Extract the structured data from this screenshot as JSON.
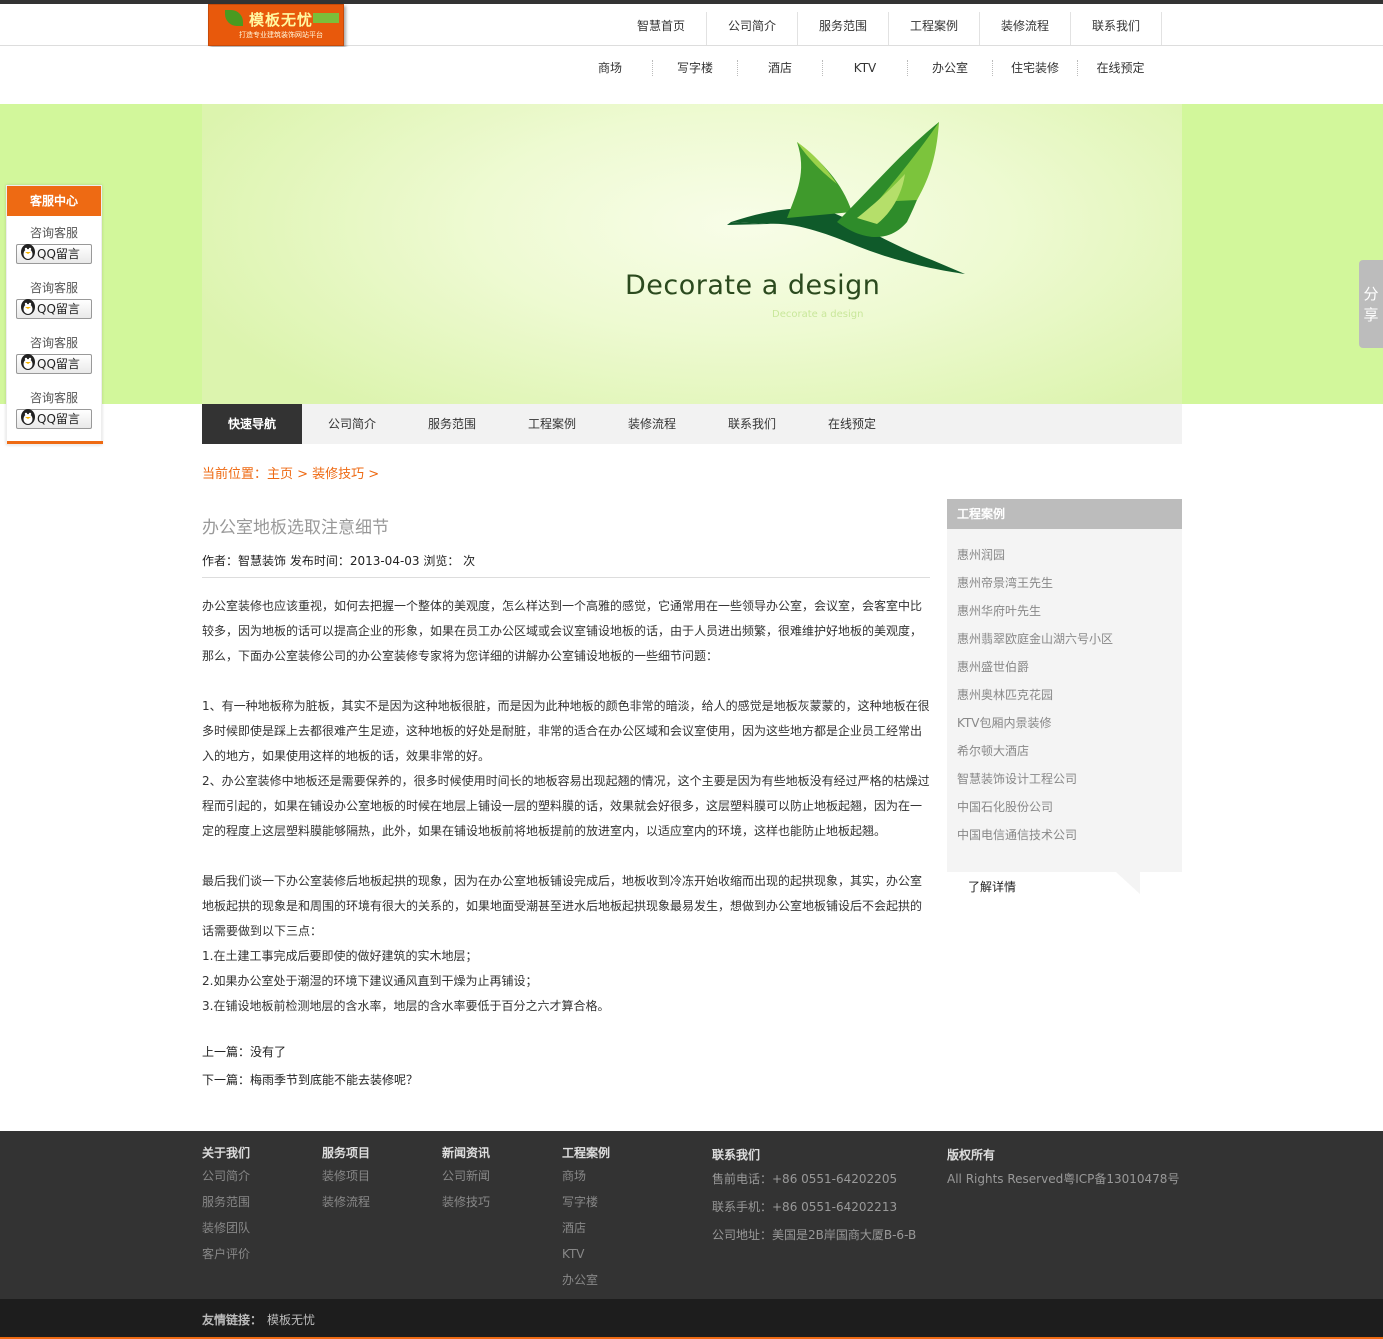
{
  "logo": {
    "title": "模板无忧",
    "subtitle": "打造专业建筑装饰网站平台"
  },
  "main_nav": [
    "智慧首页",
    "公司简介",
    "服务范围",
    "工程案例",
    "装修流程",
    "联系我们"
  ],
  "sub_nav": [
    "商场",
    "写字楼",
    "酒店",
    "KTV",
    "办公室",
    "住宅装修",
    "在线预定"
  ],
  "banner": {
    "text": "Decorate a design",
    "subtext": "Decorate a design"
  },
  "section_nav": [
    "快速导航",
    "公司简介",
    "服务范围",
    "工程案例",
    "装修流程",
    "联系我们",
    "在线预定"
  ],
  "breadcrumb": "当前位置：主页 > 装修技巧 >",
  "article": {
    "title": "办公室地板选取注意细节",
    "meta": "作者：智慧装饰 发布时间：2013-04-03 浏览： 次",
    "paragraphs": [
      "办公室装修也应该重视，如何去把握一个整体的美观度，怎么样达到一个高雅的感觉，它通常用在一些领导办公室，会议室，会客室中比较多，因为地板的话可以提高企业的形象，如果在员工办公区域或会议室铺设地板的话，由于人员进出频繁，很难维护好地板的美观度，那么，下面办公室装修公司的办公室装修专家将为您详细的讲解办公室铺设地板的一些细节问题：",
      "",
      "1、有一种地板称为脏板，其实不是因为这种地板很脏，而是因为此种地板的颜色非常的暗淡，给人的感觉是地板灰蒙蒙的，这种地板在很多时候即使是踩上去都很难产生足迹，这种地板的好处是耐脏，非常的适合在办公区域和会议室使用，因为这些地方都是企业员工经常出入的地方，如果使用这样的地板的话，效果非常的好。",
      "2、办公室装修中地板还是需要保养的，很多时候使用时间长的地板容易出现起翘的情况，这个主要是因为有些地板没有经过严格的枯燥过程而引起的，如果在铺设办公室地板的时候在地层上铺设一层的塑料膜的话，效果就会好很多，这层塑料膜可以防止地板起翘，因为在一定的程度上这层塑料膜能够隔热，此外，如果在铺设地板前将地板提前的放进室内，以适应室内的环境，这样也能防止地板起翘。",
      "",
      "最后我们谈一下办公室装修后地板起拱的现象，因为在办公室地板铺设完成后，地板收到冷冻开始收缩而出现的起拱现象，其实，办公室地板起拱的现象是和周围的环境有很大的关系的，如果地面受潮甚至进水后地板起拱现象最易发生，想做到办公室地板铺设后不会起拱的话需要做到以下三点：",
      "1.在土建工事完成后要即使的做好建筑的实木地层；",
      "2.如果办公室处于潮湿的环境下建议通风直到干燥为止再铺设；",
      "3.在铺设地板前检测地层的含水率，地层的含水率要低于百分之六才算合格。"
    ],
    "prev": "上一篇：没有了",
    "next": "下一篇：梅雨季节到底能不能去装修呢？"
  },
  "sidebar": {
    "title": "工程案例",
    "items": [
      "惠州润园",
      "惠州帝景湾王先生",
      "惠州华府叶先生",
      "惠州翡翠欧庭金山湖六号小区",
      "惠州盛世伯爵",
      "惠州奥林匹克花园",
      "KTV包厢内景装修",
      "希尔顿大酒店",
      "智慧装饰设计工程公司",
      "中国石化股份公司",
      "中国电信通信技术公司"
    ],
    "more": "了解详情"
  },
  "kefu": {
    "title": "客服中心",
    "groups": [
      {
        "label": "咨询客服",
        "button": "QQ留言"
      },
      {
        "label": "咨询客服",
        "button": "QQ留言"
      },
      {
        "label": "咨询客服",
        "button": "QQ留言"
      },
      {
        "label": "咨询客服",
        "button": "QQ留言"
      }
    ]
  },
  "share": {
    "label": "分享"
  },
  "footer": {
    "columns": [
      {
        "title": "关于我们",
        "links": [
          "公司简介",
          "服务范围",
          "装修团队",
          "客户评价"
        ]
      },
      {
        "title": "服务项目",
        "links": [
          "装修项目",
          "装修流程"
        ]
      },
      {
        "title": "新闻资讯",
        "links": [
          "公司新闻",
          "装修技巧"
        ]
      },
      {
        "title": "工程案例",
        "links": [
          "商场",
          "写字楼",
          "酒店",
          "KTV",
          "办公室"
        ]
      }
    ],
    "contact": {
      "title": "联系我们",
      "lines": [
        "售前电话：+86 0551-64202205",
        "联系手机：+86 0551-64202213",
        "公司地址：美国是2B岸国商大厦B-6-B"
      ]
    },
    "copyright": {
      "title": "版权所有",
      "text": "All Rights Reserved粤ICP备13010478号"
    }
  },
  "friend_links": {
    "label": "友情链接：",
    "items": [
      "模板无忧"
    ]
  },
  "colors": {
    "accent": "#ee6a13",
    "banner": "#d2f79b",
    "footer": "#333333",
    "dark_nav": "#333333"
  }
}
